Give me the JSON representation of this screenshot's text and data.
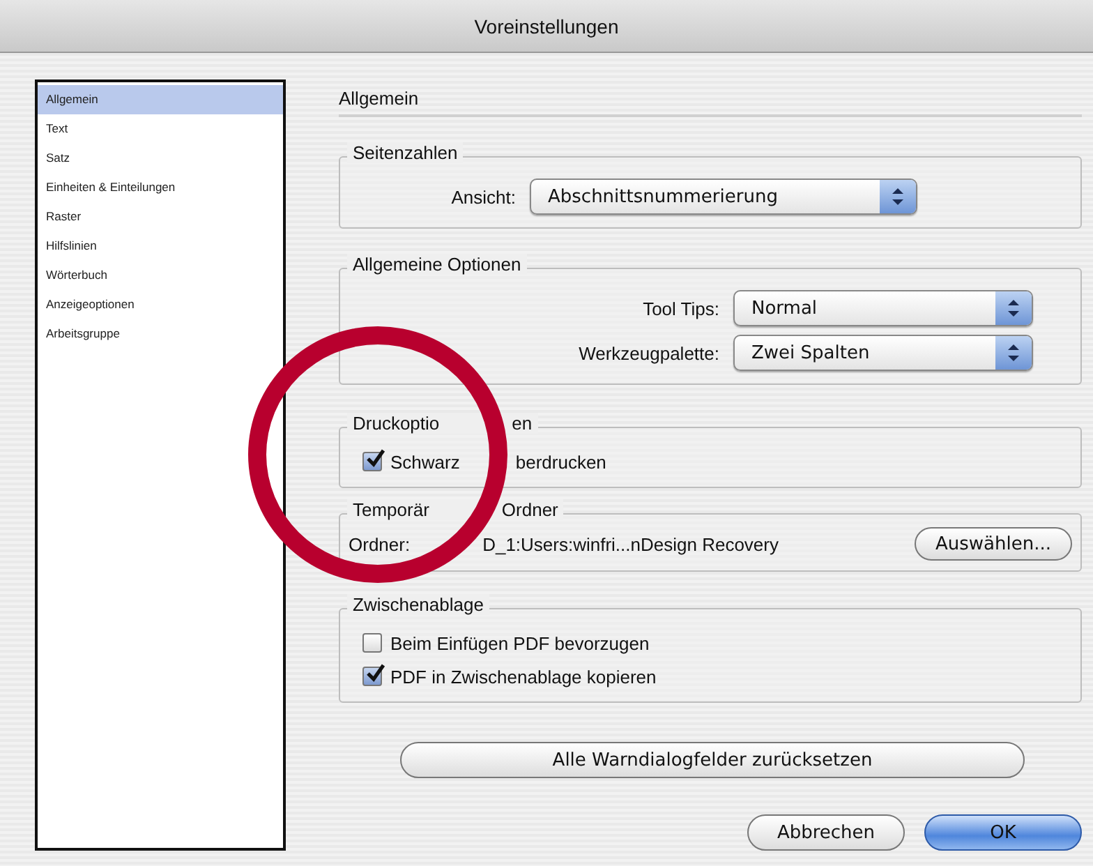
{
  "window": {
    "title": "Voreinstellungen"
  },
  "sidebar": {
    "items": [
      {
        "label": "Allgemein",
        "selected": true
      },
      {
        "label": "Text",
        "selected": false
      },
      {
        "label": "Satz",
        "selected": false
      },
      {
        "label": "Einheiten & Einteilungen",
        "selected": false
      },
      {
        "label": "Raster",
        "selected": false
      },
      {
        "label": "Hilfslinien",
        "selected": false
      },
      {
        "label": "Wörterbuch",
        "selected": false
      },
      {
        "label": "Anzeigeoptionen",
        "selected": false
      },
      {
        "label": "Arbeitsgruppe",
        "selected": false
      }
    ]
  },
  "page_title": "Allgemein",
  "groups": [
    {
      "kind": "popups",
      "legend": [
        "Seitenzahlen"
      ],
      "rows": [
        {
          "label": "Ansicht:",
          "value": "Abschnittsnummerierung"
        }
      ]
    },
    {
      "kind": "popups",
      "legend": [
        "Allgemeine Optionen"
      ],
      "rows": [
        {
          "label": "Tool Tips:",
          "value": "Normal"
        },
        {
          "label": "Werkzeugpalette:",
          "value": "Zwei Spalten"
        }
      ]
    },
    {
      "kind": "checks",
      "legend": [
        "Druckoptio",
        "en"
      ],
      "rows": [
        {
          "label": [
            "Schwarz",
            "berdrucken"
          ],
          "checked": true
        }
      ]
    },
    {
      "kind": "folder",
      "legend": [
        "Temporär",
        "Ordner"
      ],
      "label": "Ordner:",
      "path": "D_1:Users:winfri...nDesign Recovery",
      "button": "Auswählen..."
    },
    {
      "kind": "checks",
      "legend": [
        "Zwischenablage"
      ],
      "rows": [
        {
          "label": [
            "Beim Einfügen PDF bevorzugen"
          ],
          "checked": false
        },
        {
          "label": [
            "PDF in Zwischenablage kopieren"
          ],
          "checked": true
        }
      ]
    }
  ],
  "reset_button": "Alle Warndialogfelder zurücksetzen",
  "buttons": [
    {
      "label": "Abbrechen",
      "default": false
    },
    {
      "label": "OK",
      "default": true
    }
  ]
}
